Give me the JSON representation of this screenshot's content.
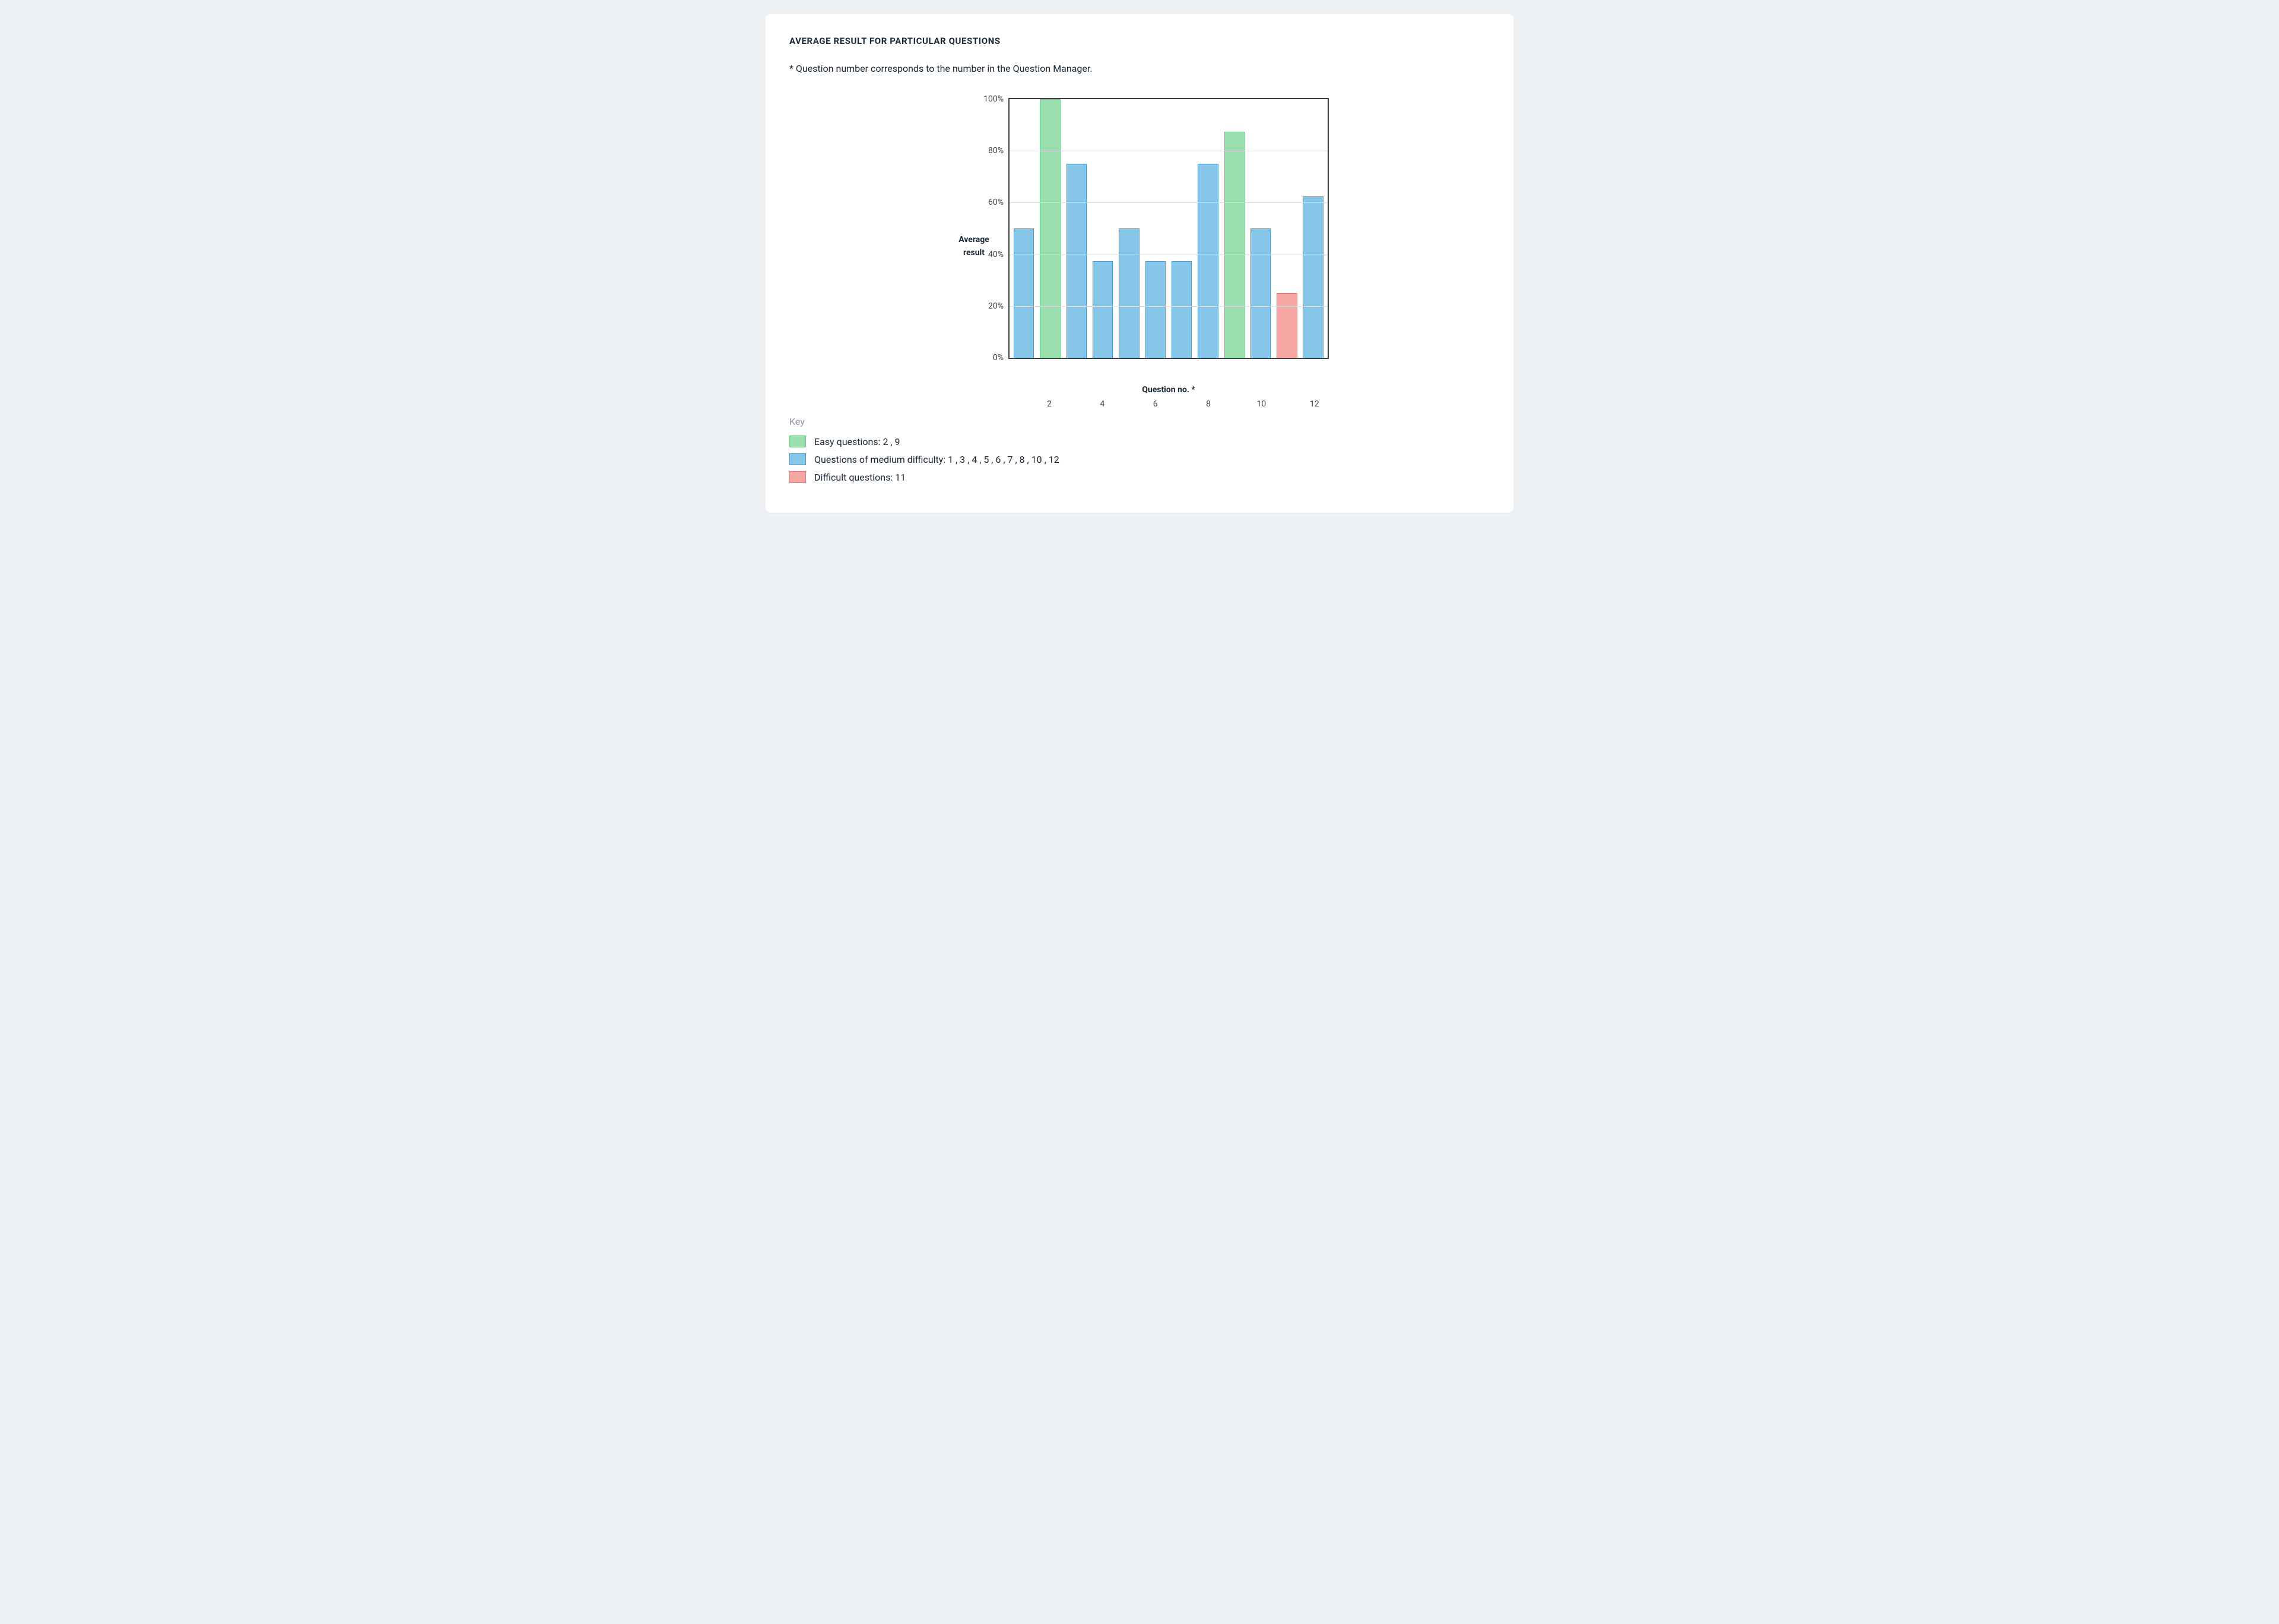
{
  "title": "AVERAGE RESULT FOR PARTICULAR QUESTIONS",
  "note": "* Question number corresponds to the number in the Question Manager.",
  "y_axis_title": "Average result",
  "x_axis_title": "Question no. *",
  "legend_title": "Key",
  "legend": {
    "easy": "Easy questions: 2 , 9",
    "medium": "Questions of medium difficulty: 1 , 3 , 4 , 5 , 6 , 7 , 8 , 10 , 12",
    "hard": "Difficult questions: 11"
  },
  "chart_data": {
    "type": "bar",
    "xlabel": "Question no. *",
    "ylabel": "Average result",
    "ylim": [
      0,
      100
    ],
    "y_ticks": [
      0,
      20,
      40,
      60,
      80,
      100
    ],
    "y_tick_labels": [
      "0%",
      "20%",
      "40%",
      "60%",
      "80%",
      "100%"
    ],
    "x_tick_positions": [
      2,
      4,
      6,
      8,
      10,
      12
    ],
    "categories": [
      1,
      2,
      3,
      4,
      5,
      6,
      7,
      8,
      9,
      10,
      11,
      12
    ],
    "values": [
      50,
      100,
      75,
      37.5,
      50,
      37.5,
      37.5,
      75,
      87.5,
      50,
      25,
      62.5
    ],
    "difficulty": [
      "medium",
      "easy",
      "medium",
      "medium",
      "medium",
      "medium",
      "medium",
      "medium",
      "easy",
      "medium",
      "hard",
      "medium"
    ],
    "colors": {
      "easy": "#9adfae",
      "medium": "#86c6e8",
      "hard": "#f6a7a3"
    }
  }
}
